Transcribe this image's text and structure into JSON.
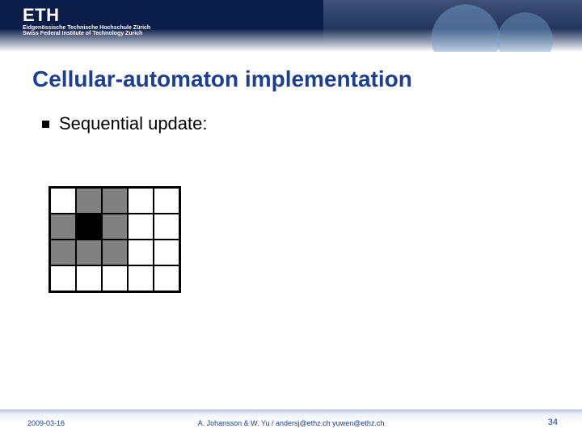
{
  "header": {
    "logo_text": "ETH",
    "logo_sub1": "Eidgenössische Technische Hochschule Zürich",
    "logo_sub2": "Swiss Federal Institute of Technology Zurich"
  },
  "title": "Cellular-automaton implementation",
  "bullet1": "Sequential update:",
  "grid": {
    "rows": 4,
    "cols": 5,
    "gray_cells": [
      "0,1",
      "0,2",
      "1,0",
      "1,2",
      "2,0",
      "2,1",
      "2,2"
    ],
    "black_cells": [
      "1,1"
    ]
  },
  "footer": {
    "date": "2009-03-16",
    "authors": "A. Johansson & W. Yu / andersj@ethz.ch yuwen@ethz.ch",
    "page": "34"
  }
}
